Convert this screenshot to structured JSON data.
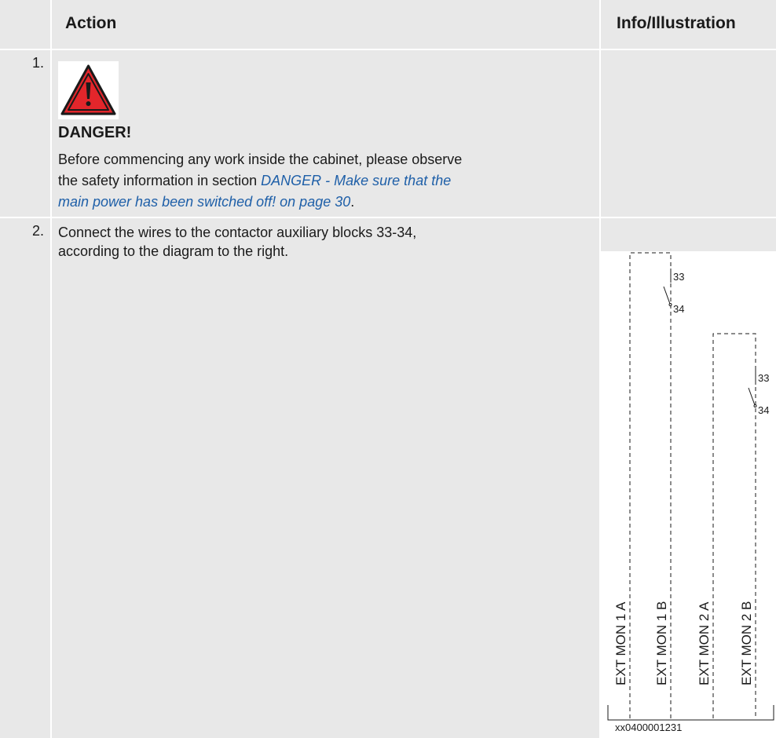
{
  "header": {
    "action_label": "Action",
    "info_label": "Info/Illustration"
  },
  "steps": [
    {
      "number": "1.",
      "danger_title": "DANGER!",
      "text_before_link": "Before commencing any work inside the cabinet, please observe",
      "text_line2_before_link": "the safety information in section ",
      "link_part1": "DANGER - Make sure that the",
      "link_part2": "main power has been switched off! on page 30",
      "text_after_link": "."
    },
    {
      "number": "2.",
      "line1": "Connect the wires to the contactor auxiliary blocks 33-34,",
      "line2": "according to the diagram to the right."
    }
  ],
  "diagram": {
    "wire_labels": [
      "EXT MON 1 A",
      "EXT MON 1 B",
      "EXT MON 2 A",
      "EXT MON 2 B"
    ],
    "contact_top": "33",
    "contact_bottom": "34",
    "figure_id": "xx0400001231"
  },
  "colors": {
    "cell_background": "#e8e8e8",
    "link": "#1e5fa8",
    "danger_red": "#e3262b"
  },
  "icons": [
    "warning-triangle-icon"
  ]
}
